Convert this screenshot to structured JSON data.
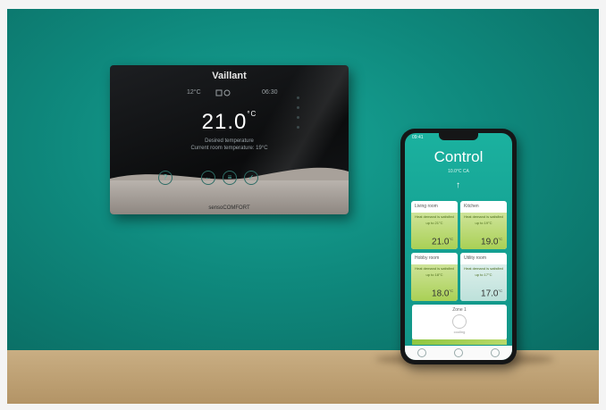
{
  "thermostat": {
    "brand": "Vaillant",
    "top_left": "12°C",
    "top_center": "",
    "top_right": "06:30",
    "temperature": "21.0",
    "temperature_unit": "°C",
    "line1": "Desired temperature",
    "line2": "Current room temperature: 19°C",
    "buttons": [
      "?",
      "←",
      "≡",
      "✓"
    ],
    "model": "sensoCOMFORT"
  },
  "phone": {
    "status_time": "09:41",
    "status_right": "",
    "title": "Control",
    "subtitle": "10.0°C  CA",
    "rooms": [
      {
        "name": "Living room",
        "note": "Heat demand is satisfied",
        "sub": "up to 21°C",
        "temp": "21.0",
        "unit": "°C",
        "style": "green"
      },
      {
        "name": "Kitchen",
        "note": "Heat demand is satisfied",
        "sub": "up to 19°C",
        "temp": "19.0",
        "unit": "°C",
        "style": "green"
      },
      {
        "name": "Hobby room",
        "note": "Heat demand is satisfied",
        "sub": "up to 18°C",
        "temp": "18.0",
        "unit": "°C",
        "style": "green"
      },
      {
        "name": "Utility room",
        "note": "Heat demand is satisfied",
        "sub": "up to 17°C",
        "temp": "17.0",
        "unit": "°C",
        "style": "blue"
      }
    ],
    "zone": {
      "name": "Zone 1",
      "label": "cooling"
    }
  }
}
